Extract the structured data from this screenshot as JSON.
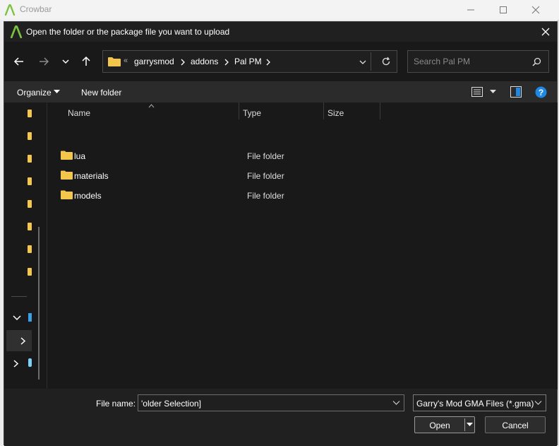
{
  "parent_window": {
    "title": "Crowbar"
  },
  "dialog": {
    "title": "Open the folder or the package file you want to upload",
    "breadcrumb": {
      "overflow": "«",
      "items": [
        "garrysmod",
        "addons",
        "Pal PM"
      ]
    },
    "search": {
      "placeholder": "Search Pal PM"
    },
    "toolbar": {
      "organize_label": "Organize",
      "new_folder_label": "New folder"
    },
    "columns": {
      "name": "Name",
      "type": "Type",
      "size": "Size"
    },
    "files": [
      {
        "name": "lua",
        "type": "File folder"
      },
      {
        "name": "materials",
        "type": "File folder"
      },
      {
        "name": "models",
        "type": "File folder"
      }
    ],
    "file_name_label": "File name:",
    "file_name_value": "'older Selection]",
    "file_type_filter": "Garry's Mod GMA Files (*.gma)",
    "open_label": "Open",
    "cancel_label": "Cancel",
    "colors": {
      "background": "#191919",
      "folder": "#f4c64b",
      "help": "#1e88e5",
      "brand": "#7cc242"
    }
  }
}
